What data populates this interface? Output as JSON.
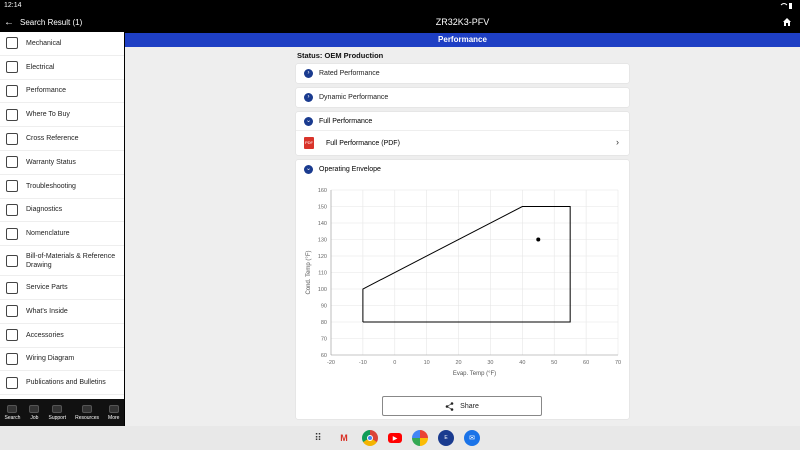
{
  "status_bar": {
    "time": "12:14"
  },
  "sidebar": {
    "header_title": "Search Result (1)",
    "items": [
      {
        "label": "Mechanical",
        "icon": "mechanical-icon"
      },
      {
        "label": "Electrical",
        "icon": "electrical-icon"
      },
      {
        "label": "Performance",
        "icon": "performance-icon"
      },
      {
        "label": "Where To Buy",
        "icon": "where-to-buy-icon"
      },
      {
        "label": "Cross Reference",
        "icon": "cross-reference-icon"
      },
      {
        "label": "Warranty Status",
        "icon": "warranty-icon"
      },
      {
        "label": "Troubleshooting",
        "icon": "troubleshooting-icon"
      },
      {
        "label": "Diagnostics",
        "icon": "diagnostics-icon"
      },
      {
        "label": "Nomenclature",
        "icon": "nomenclature-icon"
      },
      {
        "label": "Bill-of-Materials & Reference Drawing",
        "icon": "bom-icon"
      },
      {
        "label": "Service Parts",
        "icon": "service-parts-icon"
      },
      {
        "label": "What's Inside",
        "icon": "whats-inside-icon"
      },
      {
        "label": "Accessories",
        "icon": "accessories-icon"
      },
      {
        "label": "Wiring Diagram",
        "icon": "wiring-diagram-icon"
      },
      {
        "label": "Publications and Bulletins",
        "icon": "publications-icon"
      }
    ],
    "tabs": [
      {
        "label": "Search",
        "icon": "search-icon"
      },
      {
        "label": "Job",
        "icon": "job-icon"
      },
      {
        "label": "Support",
        "icon": "support-icon"
      },
      {
        "label": "Resources",
        "icon": "resources-icon"
      },
      {
        "label": "More",
        "icon": "more-icon"
      }
    ]
  },
  "header": {
    "title": "ZR32K3-PFV",
    "section": "Performance"
  },
  "main": {
    "status": "Status: OEM Production",
    "rated": "Rated Performance",
    "dynamic": "Dynamic Performance",
    "full": "Full Performance",
    "full_pdf": "Full Performance (PDF)",
    "pdf_badge": "PDF",
    "envelope": "Operating Envelope",
    "share": "Share"
  },
  "colors": {
    "accent_blue": "#1e3fc4",
    "chevron_blue": "#1a3b8f",
    "pdf_red": "#d9342b"
  },
  "chart_data": {
    "type": "line",
    "xlabel": "Evap. Temp (°F)",
    "ylabel": "Cond. Temp (°F)",
    "xlim": [
      -20,
      70
    ],
    "ylim": [
      60,
      160
    ],
    "xticks": [
      -20,
      -10,
      0,
      10,
      20,
      30,
      40,
      50,
      60,
      70
    ],
    "yticks": [
      60,
      70,
      80,
      90,
      100,
      110,
      120,
      130,
      140,
      150,
      160
    ],
    "grid": true,
    "series": [
      {
        "points": [
          [
            -10,
            80
          ],
          [
            -10,
            100
          ],
          [
            40,
            150
          ],
          [
            55,
            150
          ],
          [
            55,
            80
          ],
          [
            -10,
            80
          ]
        ]
      }
    ],
    "point": {
      "x": 45,
      "y": 130
    }
  }
}
